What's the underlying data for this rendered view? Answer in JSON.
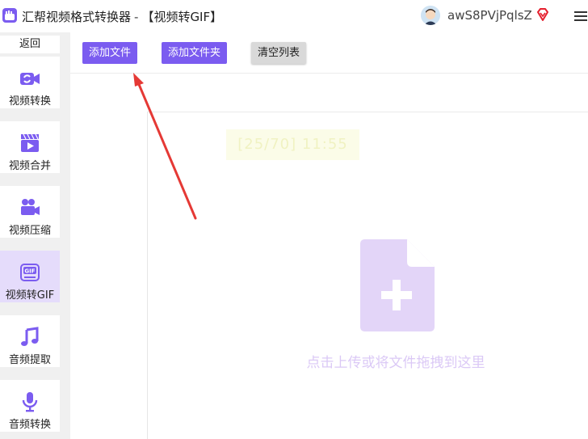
{
  "app": {
    "title": "汇帮视频格式转换器",
    "separator": "-",
    "mode": "【视频转GIF】"
  },
  "user": {
    "name": "awS8PVjPqlsZ"
  },
  "sidebar": {
    "back_label": "返回",
    "items": [
      {
        "label": "视频转换",
        "icon": "video-convert-icon"
      },
      {
        "label": "视频合并",
        "icon": "video-merge-icon"
      },
      {
        "label": "视频压缩",
        "icon": "video-compress-icon"
      },
      {
        "label": "视频转GIF",
        "icon": "gif-icon",
        "active": true
      },
      {
        "label": "音频提取",
        "icon": "music-note-icon"
      },
      {
        "label": "音频转换",
        "icon": "microphone-icon"
      }
    ]
  },
  "toolbar": {
    "add_file_label": "添加文件",
    "add_folder_label": "添加文件夹",
    "clear_list_label": "清空列表"
  },
  "dropzone": {
    "hint": "点击上传或将文件拖拽到这里",
    "watermark": "[25/70] 11:55"
  },
  "colors": {
    "accent": "#7b5cf0",
    "active_nav": "#e5dcfb",
    "dropzone_icon": "#e3d5f8",
    "annotation_arrow": "#e53935"
  }
}
